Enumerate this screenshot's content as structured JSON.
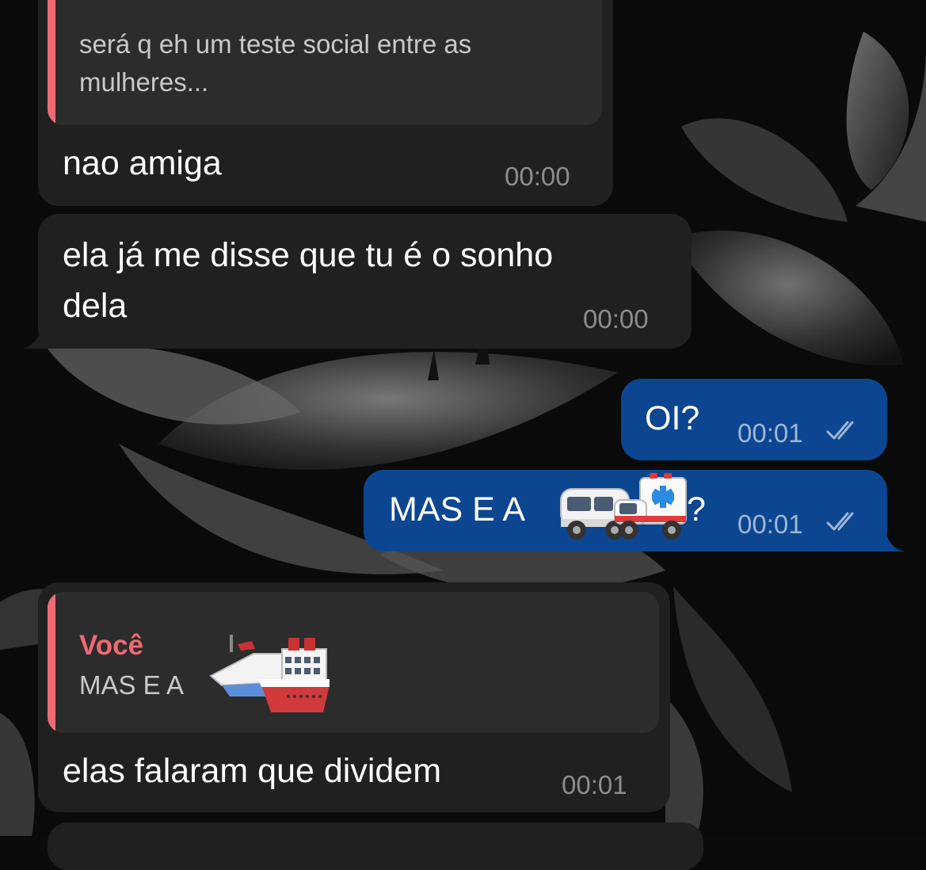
{
  "messages": [
    {
      "id": "m1",
      "direction": "incoming",
      "reply": {
        "text": "será q eh um teste social entre as mulheres..."
      },
      "text": "nao amiga",
      "time": "00:00"
    },
    {
      "id": "m2",
      "direction": "incoming",
      "text_line1": "ela já me disse que tu é o sonho",
      "text_line2": "dela",
      "time": "00:00"
    },
    {
      "id": "m3",
      "direction": "outgoing",
      "text": "OI?",
      "time": "00:01",
      "status": "read"
    },
    {
      "id": "m4",
      "direction": "outgoing",
      "text_prefix": "MAS E A ",
      "text_suffix": "?",
      "emoji": [
        "minibus",
        "ambulance"
      ],
      "time": "00:01",
      "status": "read"
    },
    {
      "id": "m5",
      "direction": "incoming",
      "reply": {
        "sender": "Você",
        "text": "MAS E A ",
        "emoji": [
          "ship"
        ]
      },
      "text": "elas falaram que dividem",
      "time": "00:01"
    }
  ],
  "colors": {
    "incoming_bubble": "#202021",
    "outgoing_bubble": "#0c4690",
    "reply_accent": "#f06a73",
    "quote_background": "#2c2c2d"
  }
}
